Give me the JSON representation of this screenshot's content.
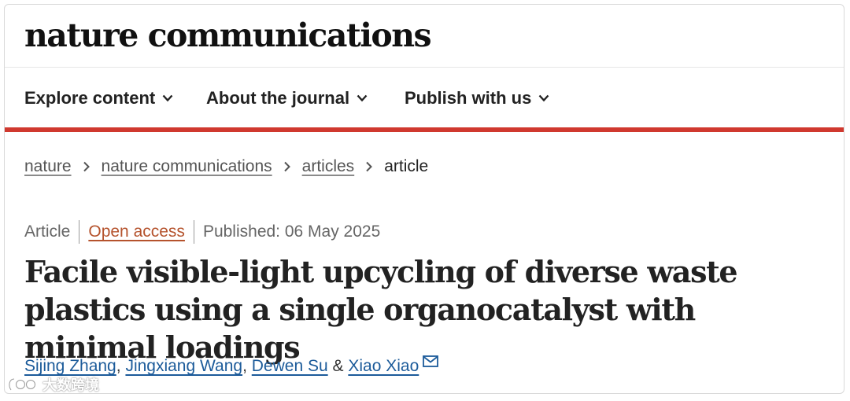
{
  "header": {
    "logo": "nature communications"
  },
  "nav": {
    "items": [
      {
        "label": "Explore content"
      },
      {
        "label": "About the journal"
      },
      {
        "label": "Publish with us"
      }
    ]
  },
  "breadcrumb": {
    "items": [
      "nature",
      "nature communications",
      "articles"
    ],
    "current": "article"
  },
  "article": {
    "type": "Article",
    "access": "Open access",
    "published": "Published: 06 May 2025",
    "title": "Facile visible-light upcycling of diverse waste plastics using a single organocatalyst with minimal loadings",
    "authors": [
      "Sijing Zhang",
      "Jingxiang Wang",
      "Dewen Su",
      "Xiao Xiao"
    ],
    "separators": {
      "comma": ",",
      "and": "&"
    }
  },
  "watermark": {
    "text": "大数跨境"
  },
  "colors": {
    "accent_rule": "#d0392f",
    "author_link": "#1c5b9a",
    "open_access": "#b5532d"
  }
}
